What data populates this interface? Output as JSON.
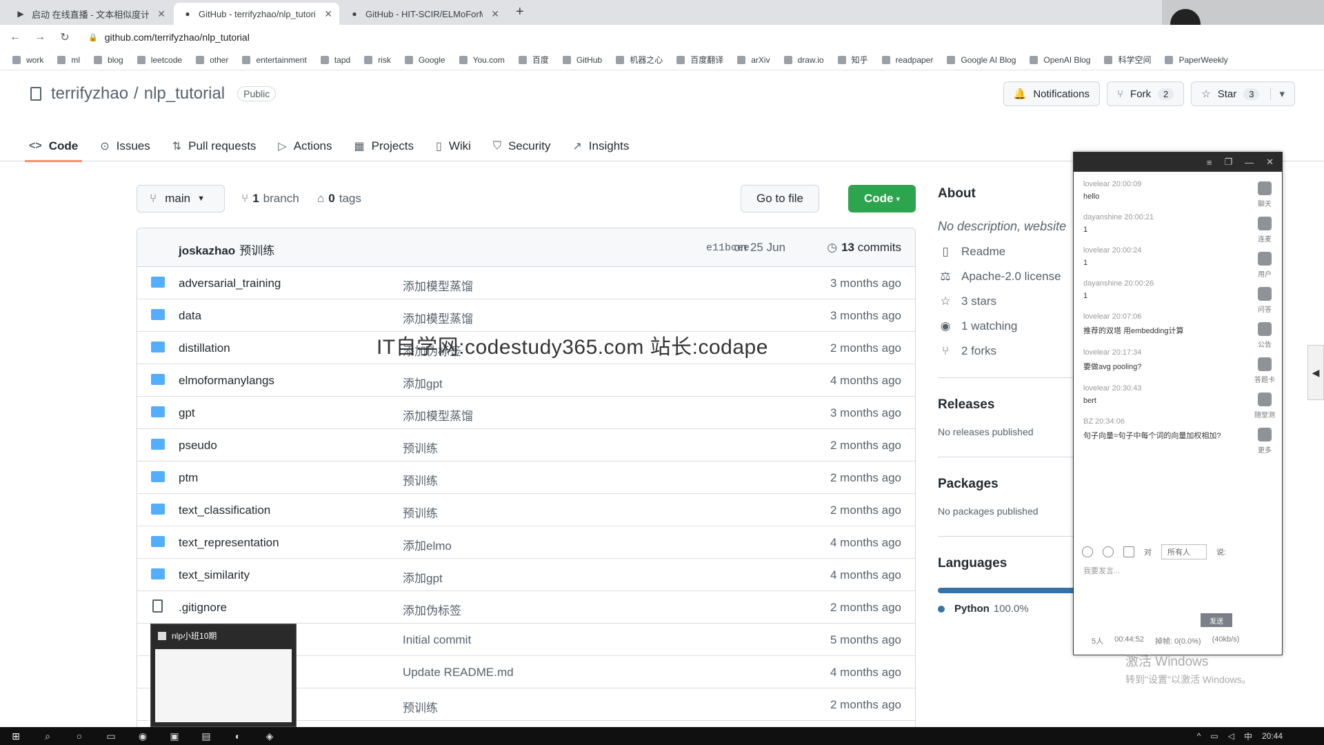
{
  "browser": {
    "tabs": [
      {
        "title": "启动 在线直播 - 文本相似度计算",
        "favicon": "video-icon",
        "active": false
      },
      {
        "title": "GitHub - terrifyzhao/nlp_tutorial",
        "favicon": "github-icon",
        "active": true
      },
      {
        "title": "GitHub - HIT-SCIR/ELMoForM...",
        "favicon": "github-icon",
        "active": false
      }
    ],
    "new_tab": "+",
    "url": "github.com/terrifyzhao/nlp_tutorial",
    "bookmarks": [
      "work",
      "ml",
      "blog",
      "leetcode",
      "other",
      "entertainment",
      "tapd",
      "risk",
      "Google",
      "You.com",
      "百度",
      "GitHub",
      "机器之心",
      "百度翻译",
      "arXiv",
      "draw.io",
      "知乎",
      "readpaper",
      "Google AI Blog",
      "OpenAI Blog",
      "科学空间",
      "PaperWeekly"
    ]
  },
  "repo": {
    "owner": "terrifyzhao",
    "name": "nlp_tutorial",
    "visibility": "Public",
    "actions": {
      "notifications": "Notifications",
      "fork": "Fork",
      "fork_count": "2",
      "star": "Star",
      "star_count": "3"
    },
    "nav": [
      "Code",
      "Issues",
      "Pull requests",
      "Actions",
      "Projects",
      "Wiki",
      "Security",
      "Insights"
    ]
  },
  "toolbar": {
    "branch": "main",
    "branches_count": "1",
    "branches_label": "branch",
    "tags_count": "0",
    "tags_label": "tags",
    "goto": "Go to file",
    "code": "Code"
  },
  "commit": {
    "author": "joskazhao",
    "message": "预训练",
    "sha": "e11bcee",
    "date": "on 25 Jun",
    "commits_count": "13",
    "commits_label": "commits"
  },
  "files": [
    {
      "name": "adversarial_training",
      "message": "添加模型蒸馏",
      "age": "3 months ago",
      "type": "dir"
    },
    {
      "name": "data",
      "message": "添加模型蒸馏",
      "age": "3 months ago",
      "type": "dir"
    },
    {
      "name": "distillation",
      "message": "添加伪标签",
      "age": "2 months ago",
      "type": "dir"
    },
    {
      "name": "elmoformanylangs",
      "message": "添加gpt",
      "age": "4 months ago",
      "type": "dir"
    },
    {
      "name": "gpt",
      "message": "添加模型蒸馏",
      "age": "3 months ago",
      "type": "dir"
    },
    {
      "name": "pseudo",
      "message": "预训练",
      "age": "2 months ago",
      "type": "dir"
    },
    {
      "name": "ptm",
      "message": "预训练",
      "age": "2 months ago",
      "type": "dir"
    },
    {
      "name": "text_classification",
      "message": "预训练",
      "age": "2 months ago",
      "type": "dir"
    },
    {
      "name": "text_representation",
      "message": "添加elmo",
      "age": "4 months ago",
      "type": "dir"
    },
    {
      "name": "text_similarity",
      "message": "添加gpt",
      "age": "4 months ago",
      "type": "dir"
    },
    {
      "name": ".gitignore",
      "message": "添加伪标签",
      "age": "2 months ago",
      "type": "file"
    },
    {
      "name": "",
      "message": "Initial commit",
      "age": "5 months ago",
      "type": "file"
    },
    {
      "name": "",
      "message": "Update README.md",
      "age": "4 months ago",
      "type": "file"
    },
    {
      "name": "",
      "message": "预训练",
      "age": "2 months ago",
      "type": "file"
    }
  ],
  "about": {
    "heading": "About",
    "description": "No description, website",
    "items": [
      {
        "icon": "book-icon",
        "label": "Readme"
      },
      {
        "icon": "scale-icon",
        "label": "Apache-2.0 license"
      },
      {
        "icon": "star-icon",
        "label": "3 stars"
      },
      {
        "icon": "eye-icon",
        "label": "1 watching"
      },
      {
        "icon": "fork-icon",
        "label": "2 forks"
      }
    ],
    "releases_heading": "Releases",
    "releases_text": "No releases published",
    "packages_heading": "Packages",
    "packages_text": "No packages published",
    "languages_heading": "Languages",
    "language": "Python",
    "language_pct": "100.0%",
    "language_color": "#3572A5"
  },
  "chat": {
    "messages": [
      {
        "who": "lovelear 20:00:09",
        "text": "hello"
      },
      {
        "who": "dayanshine 20:00:21",
        "text": "1"
      },
      {
        "who": "lovelear 20:00:24",
        "text": "1"
      },
      {
        "who": "dayanshine 20:00:26",
        "text": "1"
      },
      {
        "who": "lovelear 20:07:06",
        "text": "推荐的双塔  用embedding计算"
      },
      {
        "who": "lovelear 20:17:34",
        "text": "要做avg  pooling?"
      },
      {
        "who": "lovelear 20:30:43",
        "text": "bert"
      },
      {
        "who": "BZ 20:34:06",
        "text": "句子向量=句子中每个词的向量加权相加?"
      }
    ],
    "side": [
      "聊天",
      "连麦",
      "用户",
      "问答",
      "公告",
      "答题卡",
      "随堂测",
      "更多"
    ],
    "to_label": "对",
    "to_select": "所有人",
    "say_label": "说:",
    "placeholder": "我要发言...",
    "send": "发送",
    "status": [
      "5人",
      "00:44:52",
      "掉帧: 0(0.0%)",
      "(40kb/s)"
    ]
  },
  "windows_activate": {
    "line1": "激活 Windows",
    "line2": "转到\"设置\"以激活 Windows。"
  },
  "watermark": "IT自学网:codestudy365.com 站长:codape",
  "thumbnail": {
    "title": "nlp小班10期"
  },
  "taskbar": {
    "clock": "20:44",
    "ime": "中"
  }
}
